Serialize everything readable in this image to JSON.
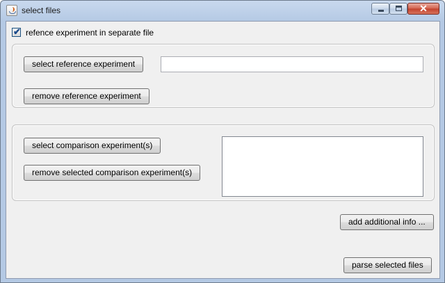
{
  "window": {
    "title": "select files",
    "controls": {
      "close_glyph": "✕"
    }
  },
  "options": {
    "separate_file_label": "refence experiment in separate file",
    "separate_file_checked": true,
    "check_glyph": "✔"
  },
  "reference_panel": {
    "select_button": "select reference experiment",
    "remove_button": "remove reference experiment",
    "path_value": ""
  },
  "comparison_panel": {
    "select_button": "select comparison experiment(s)",
    "remove_button": "remove selected comparison experiment(s)",
    "selected_files": []
  },
  "actions": {
    "additional_info_button": "add additional info ...",
    "parse_button": "parse selected files"
  }
}
